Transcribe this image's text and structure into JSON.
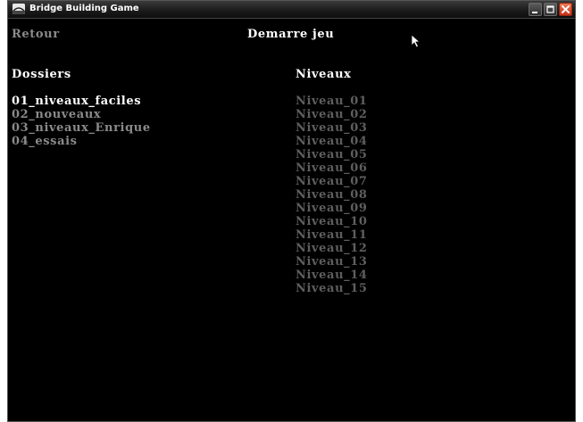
{
  "window": {
    "title": "Bridge Building Game",
    "icon": "bridge-app-icon"
  },
  "header": {
    "back_label": "Retour",
    "start_label": "Demarre jeu"
  },
  "folders": {
    "heading": "Dossiers",
    "selected_index": 0,
    "items": [
      {
        "label": "01_niveaux_faciles"
      },
      {
        "label": "02_nouveaux"
      },
      {
        "label": "03_niveaux_Enrique"
      },
      {
        "label": "04_essais"
      }
    ]
  },
  "levels": {
    "heading": "Niveaux",
    "items": [
      {
        "label": "Niveau_01"
      },
      {
        "label": "Niveau_02"
      },
      {
        "label": "Niveau_03"
      },
      {
        "label": "Niveau_04"
      },
      {
        "label": "Niveau_05"
      },
      {
        "label": "Niveau_06"
      },
      {
        "label": "Niveau_07"
      },
      {
        "label": "Niveau_08"
      },
      {
        "label": "Niveau_09"
      },
      {
        "label": "Niveau_10"
      },
      {
        "label": "Niveau_11"
      },
      {
        "label": "Niveau_12"
      },
      {
        "label": "Niveau_13"
      },
      {
        "label": "Niveau_14"
      },
      {
        "label": "Niveau_15"
      }
    ]
  },
  "colors": {
    "background": "#000000",
    "text_active": "#ffffff",
    "text_inactive": "#8a8a8a",
    "text_dim": "#5e5e5e",
    "close_button": "#d9472a"
  }
}
